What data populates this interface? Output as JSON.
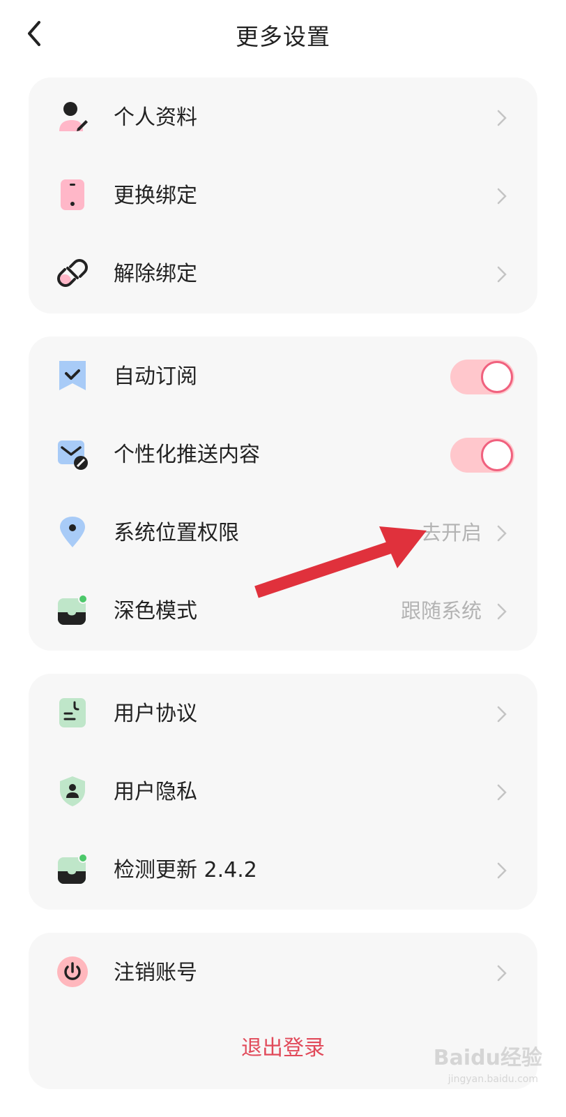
{
  "header": {
    "title": "更多设置"
  },
  "group1": {
    "items": [
      {
        "label": "个人资料",
        "icon": "user-edit-icon"
      },
      {
        "label": "更换绑定",
        "icon": "phone-icon"
      },
      {
        "label": "解除绑定",
        "icon": "unlink-icon"
      }
    ]
  },
  "group2": {
    "items": [
      {
        "label": "自动订阅",
        "icon": "bookmark-check-icon",
        "toggle": true
      },
      {
        "label": "个性化推送内容",
        "icon": "mail-block-icon",
        "toggle": true
      },
      {
        "label": "系统位置权限",
        "icon": "location-pin-icon",
        "value": "去开启"
      },
      {
        "label": "深色模式",
        "icon": "dark-mode-icon",
        "value": "跟随系统"
      }
    ]
  },
  "group3": {
    "items": [
      {
        "label": "用户协议",
        "icon": "document-icon"
      },
      {
        "label": "用户隐私",
        "icon": "shield-user-icon"
      },
      {
        "label": "检测更新 2.4.2",
        "icon": "update-icon"
      }
    ]
  },
  "group4": {
    "items": [
      {
        "label": "注销账号",
        "icon": "power-icon"
      }
    ],
    "logout_label": "退出登录"
  },
  "watermark": {
    "main": "Baidu经验",
    "sub": "jingyan.baidu.com"
  },
  "colors": {
    "accent": "#f0617e",
    "toggle_track": "#ffc7cc",
    "logout": "#e14a5a",
    "card_bg": "#f7f7f7",
    "arrow": "#e0313c"
  }
}
